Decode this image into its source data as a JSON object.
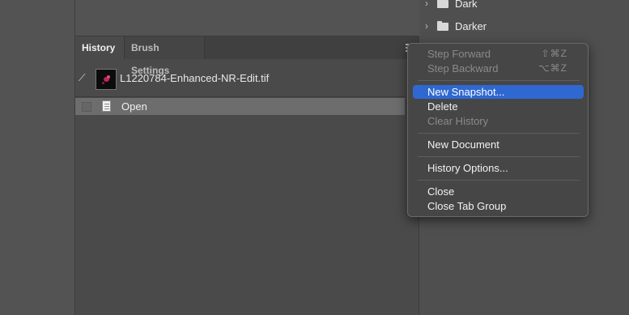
{
  "history_panel": {
    "tabs": [
      {
        "label": "History"
      },
      {
        "label": "Brush Settings"
      }
    ],
    "snapshot": {
      "name": "L1220784-Enhanced-NR-Edit.tif"
    },
    "states": [
      {
        "label": "Open"
      }
    ]
  },
  "right_panel": {
    "folders": [
      {
        "name": "Dark"
      },
      {
        "name": "Darker"
      }
    ]
  },
  "context_menu": {
    "items": [
      {
        "label": "Step Forward",
        "shortcut": "⇧⌘Z",
        "enabled": false
      },
      {
        "label": "Step Backward",
        "shortcut": "⌥⌘Z",
        "enabled": false
      },
      {
        "label": "New Snapshot...",
        "enabled": true,
        "highlighted": true
      },
      {
        "label": "Delete",
        "enabled": true
      },
      {
        "label": "Clear History",
        "enabled": false
      },
      {
        "label": "New Document",
        "enabled": true
      },
      {
        "label": "History Options...",
        "enabled": true
      },
      {
        "label": "Close",
        "enabled": true
      },
      {
        "label": "Close Tab Group",
        "enabled": true
      }
    ]
  },
  "icons": {
    "brush_source": "history-brush-icon",
    "state": "document-icon",
    "folder": "folder-icon",
    "chevron": "chevron-right-icon",
    "panel_menu": "panel-menu-icon"
  },
  "colors": {
    "highlight": "#2f68d1",
    "panel_bg": "#4a4a4a",
    "selected_state": "#6d6d6d"
  }
}
